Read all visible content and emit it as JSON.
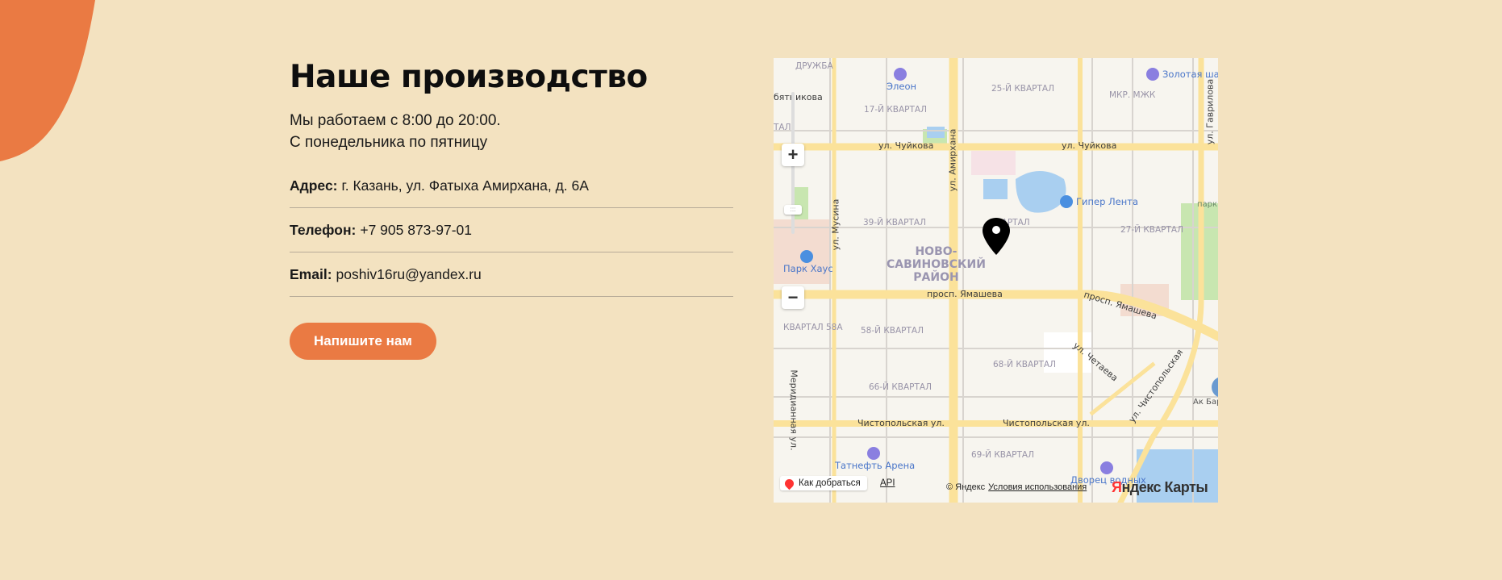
{
  "header": {
    "title": "Наше производство"
  },
  "schedule": {
    "line1": "Мы работаем с 8:00 до 20:00.",
    "line2": "С понедельника по пятницу"
  },
  "contacts": [
    {
      "label": "Адрес:",
      "value": "г. Казань, ул. Фатыха Амирхана, д. 6А"
    },
    {
      "label": "Телефон:",
      "value": "+7 905 873-97-01"
    },
    {
      "label": "Email:",
      "value": "poshiv16ru@yandex.ru"
    }
  ],
  "cta": {
    "label": "Напишите нам"
  },
  "colors": {
    "background": "#f3e2c0",
    "accent": "#ea7a43"
  },
  "map": {
    "district": "НОВО-\nСАВИНОВСКИЙ\nРАЙОН",
    "district_lines": [
      "НОВО-",
      "САВИНОВСКИЙ",
      "РАЙОН"
    ],
    "blocks": [
      "ДРУЖБА",
      "17-Й КВАРТАЛ",
      "25-Й КВАРТАЛ",
      "МКР. МЖК",
      "39-Й КВАРТАЛ",
      "27-Й КВАРТАЛ",
      "КВАРТАЛ 58А",
      "58-Й КВАРТАЛ",
      "68-Й КВАРТАЛ",
      "66-Й КВАРТАЛ",
      "69-Й КВАРТАЛ",
      "ТАЛ",
      "КВАРТАЛ"
    ],
    "streets": [
      "ул. Чуйкова",
      "ул. Чуйкова",
      "просп. Ямашева",
      "просп. Ямашева",
      "Чистопольская ул.",
      "Чистопольская ул.",
      "ул. Амирхана",
      "ул. Мусина",
      "ул. Гаврилова",
      "ул. Чистопольская",
      "ул. Четаева",
      "Меридианная ул.",
      "бятникова"
    ],
    "pois": [
      "Элеон",
      "Золотая шайба",
      "Гипер Лента",
      "Парк Хаус",
      "Татнефть Арена",
      "Дворец водных",
      "Ак Барс Арена",
      "парк"
    ],
    "controls": {
      "zoom_in": "+",
      "zoom_out": "−",
      "thumb": ":::",
      "route": "Как добраться",
      "api": "API",
      "copyright": "© Яндекс",
      "terms": "Условия использования",
      "logo_prefix": "Я",
      "logo_rest": "ндекс Карты"
    },
    "icons": [
      "zoom-in-icon",
      "zoom-out-icon",
      "location-pin-icon",
      "route-pin-icon"
    ]
  }
}
